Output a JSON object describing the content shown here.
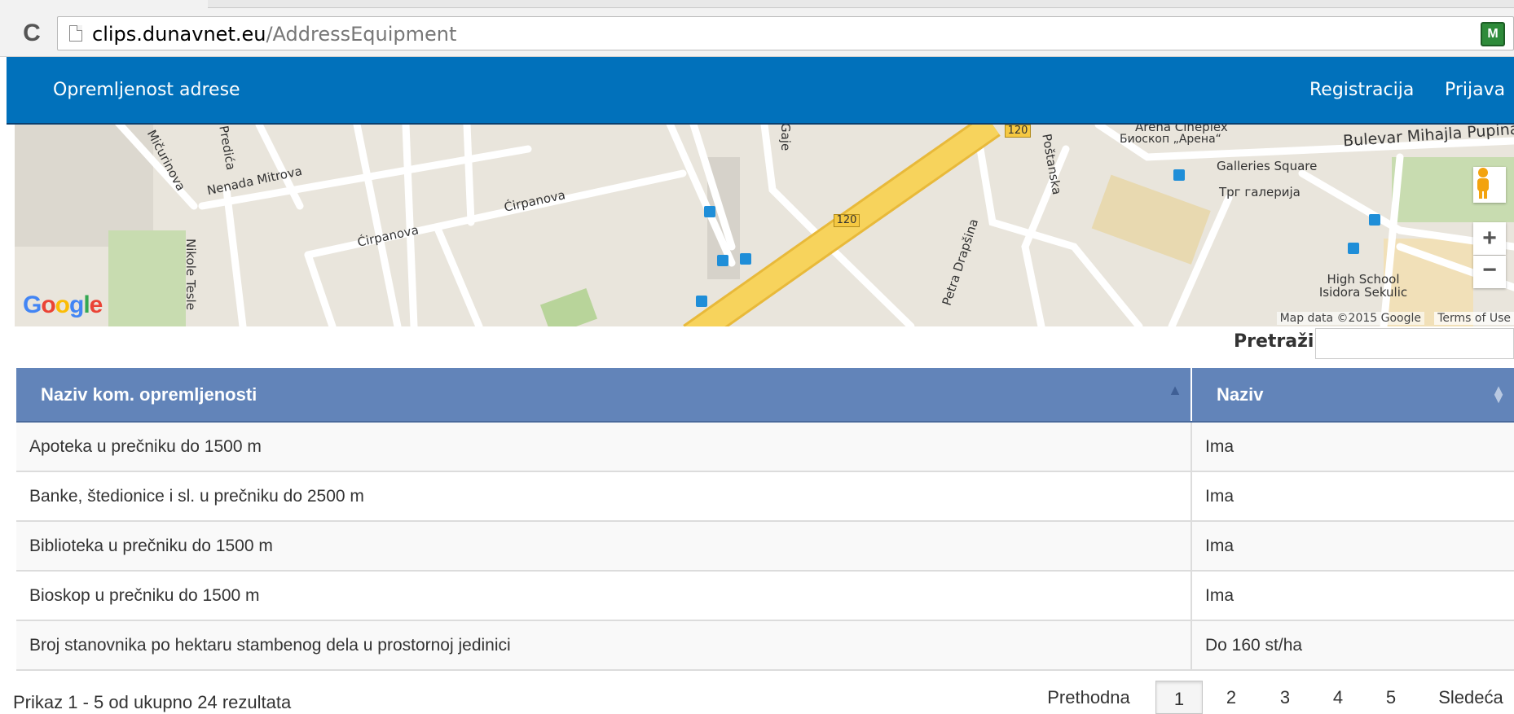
{
  "browser": {
    "url_host": "clips.dunavnet.eu",
    "url_path": "/AddressEquipment"
  },
  "navbar": {
    "brand": "Opremljenost adrese",
    "links": [
      "Registracija",
      "Prijava"
    ]
  },
  "map": {
    "labels": [
      "Mičurinova",
      "Nenada Mitrova",
      "Nikole Tesle",
      "Ćirpanova",
      "Ćirpanova",
      "Poštanska",
      "Petra Drapšina",
      "Bulevar Mihajla Pupina",
      "Galleries Square",
      "Трг галерија",
      "High School Isidora Sekulic",
      "Arena Cineplex",
      "Биоскоп „Арена“",
      "Predića",
      "Gaje",
      "120"
    ],
    "copyright": "Map data ©2015 Google",
    "terms": "Terms of Use",
    "logo": "Google"
  },
  "search": {
    "label": "Pretraži:",
    "value": ""
  },
  "table": {
    "headers": [
      "Naziv kom. opremljenosti",
      "Naziv"
    ],
    "rows": [
      [
        "Apoteka u prečniku do 1500 m",
        "Ima"
      ],
      [
        "Banke, štedionice i sl. u prečniku do 2500 m",
        "Ima"
      ],
      [
        "Biblioteka u prečniku do 1500 m",
        "Ima"
      ],
      [
        "Bioskop u prečniku do 1500 m",
        "Ima"
      ],
      [
        "Broj stanovnika po hektaru stambenog dela u prostornoj jedinici",
        "Do 160 st/ha"
      ]
    ]
  },
  "info": "Prikaz 1 - 5 od ukupno 24 rezultata",
  "pagination": {
    "prev": "Prethodna",
    "pages": [
      "1",
      "2",
      "3",
      "4",
      "5"
    ],
    "next": "Sledeća",
    "active": "1"
  },
  "colors": {
    "navbar": "#0171bb",
    "table_header": "#6284b9",
    "road_main": "#f5c842"
  }
}
